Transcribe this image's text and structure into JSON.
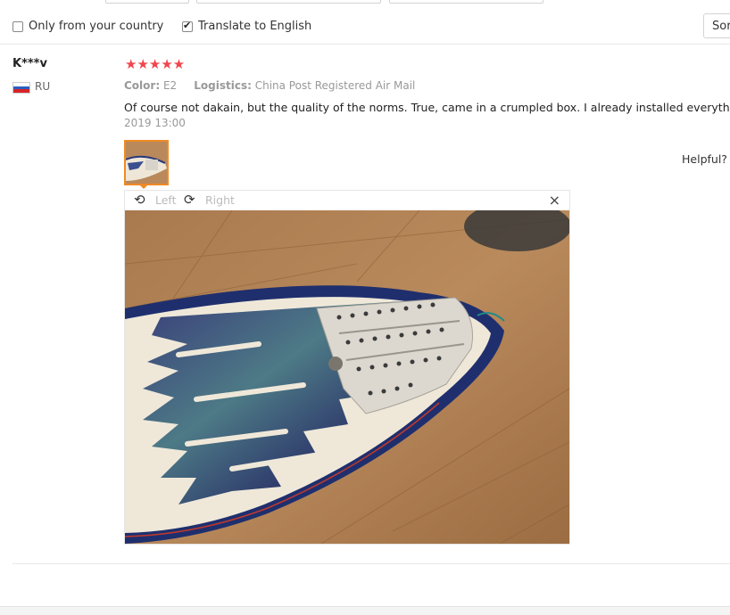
{
  "filters": {
    "only_country_label": "Only from your country",
    "only_country_checked": false,
    "translate_label": "Translate to English",
    "translate_checked": true,
    "sort_label": "Sor"
  },
  "review": {
    "buyer_name": "K***v",
    "country_code": "RU",
    "rating": 5,
    "stars": "★★★★★",
    "color_label": "Color:",
    "color_value": "E2",
    "logistics_label": "Logistics:",
    "logistics_value": "China Post Registered Air Mail",
    "text": "Of course not dakain, but the quality of the norms. True, came in a crumpled box. I already installed everything.",
    "date": "2019 13:00",
    "helpful_label": "Helpful?"
  },
  "viewer": {
    "rotate_left_icon": "rotate-left-icon",
    "rotate_left_label": "Left",
    "rotate_right_icon": "rotate-right-icon",
    "rotate_right_label": "Right",
    "close_icon": "close-icon",
    "close_glyph": "×"
  },
  "colors": {
    "star": "#f0454d",
    "thumb_border": "#f08a24",
    "muted_text": "#999999"
  }
}
